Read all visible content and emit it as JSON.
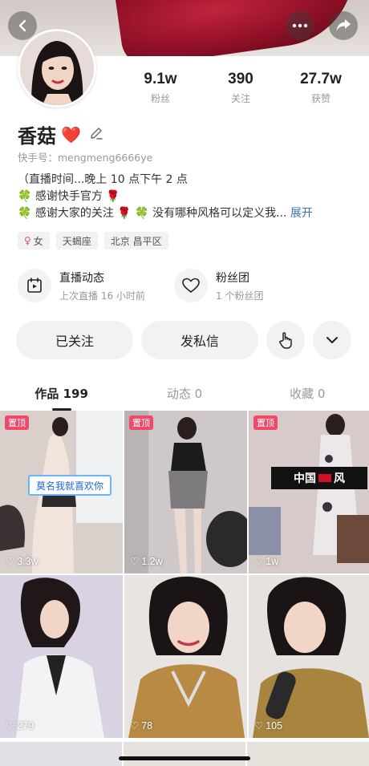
{
  "header": {
    "back_icon": "back-icon",
    "more_icon": "more-icon",
    "share_icon": "share-icon"
  },
  "profile": {
    "name": "香菇",
    "name_badge": "❤️",
    "user_id": "快手号：mengmeng6666ye",
    "stats": [
      {
        "value": "9.1w",
        "label": "粉丝"
      },
      {
        "value": "390",
        "label": "关注"
      },
      {
        "value": "27.7w",
        "label": "获赞"
      }
    ],
    "bio": [
      "（直播时间...晚上 10 点下午 2 点",
      "🍀 感谢快手官方 🌹",
      "🍀 感谢大家的关注 🌹 🍀 没有哪种风格可以定义我..."
    ],
    "bio_more": "展开",
    "tags": [
      {
        "icon": "♀",
        "text": "女"
      },
      {
        "icon": "",
        "text": "天蝎座"
      },
      {
        "icon": "",
        "text": "北京 昌平区"
      }
    ]
  },
  "live": {
    "items": [
      {
        "title": "直播动态",
        "subtitle": "上次直播 16 小时前",
        "icon": "calendar-icon"
      },
      {
        "title": "粉丝团",
        "subtitle": "1 个粉丝团",
        "icon": "heart-icon"
      }
    ]
  },
  "actions": {
    "followed": "已关注",
    "message": "发私信"
  },
  "tabs": [
    {
      "label": "作品 199",
      "active": true
    },
    {
      "label": "动态 0",
      "active": false
    },
    {
      "label": "收藏 0",
      "active": false
    }
  ],
  "posts": [
    {
      "pinned": true,
      "pin_label": "置顶",
      "likes": "3.3w",
      "caption": "莫名我就喜欢你",
      "bg": "#d9d0cc"
    },
    {
      "pinned": true,
      "pin_label": "置顶",
      "likes": "1.2w",
      "caption": "",
      "bg": "#cfc8c8"
    },
    {
      "pinned": true,
      "pin_label": "置顶",
      "likes": "1w",
      "caption": "中国",
      "caption2": "风",
      "bg": "#d6cbc8"
    },
    {
      "pinned": false,
      "likes": "279",
      "caption": "",
      "bg": "#c9c2d4"
    },
    {
      "pinned": false,
      "likes": "78",
      "caption": "",
      "bg": "#b89060"
    },
    {
      "pinned": false,
      "likes": "105",
      "caption": "",
      "bg": "#a88850"
    }
  ],
  "colors": {
    "accent_pin": "#f04a6a",
    "link": "#3b6fb6"
  }
}
